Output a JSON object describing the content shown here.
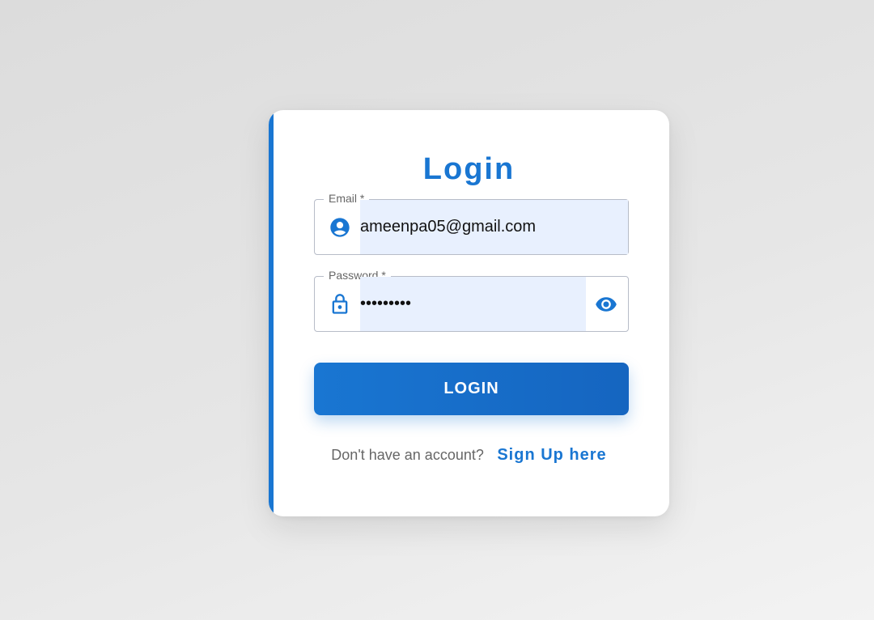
{
  "colors": {
    "accent": "#1976d2",
    "field_fill": "#e8f0fe",
    "muted_text": "#666666"
  },
  "login_card": {
    "title": "Login",
    "email": {
      "label": "Email *",
      "value": "ameenpa05@gmail.com",
      "icon": "account-circle-icon"
    },
    "password": {
      "label": "Password *",
      "value": "•••••••••",
      "icon": "lock-icon",
      "toggle_icon": "eye-icon"
    },
    "submit_label": "LOGIN",
    "signup": {
      "prompt": "Don't have an account?",
      "link_label": "Sign Up here"
    }
  }
}
